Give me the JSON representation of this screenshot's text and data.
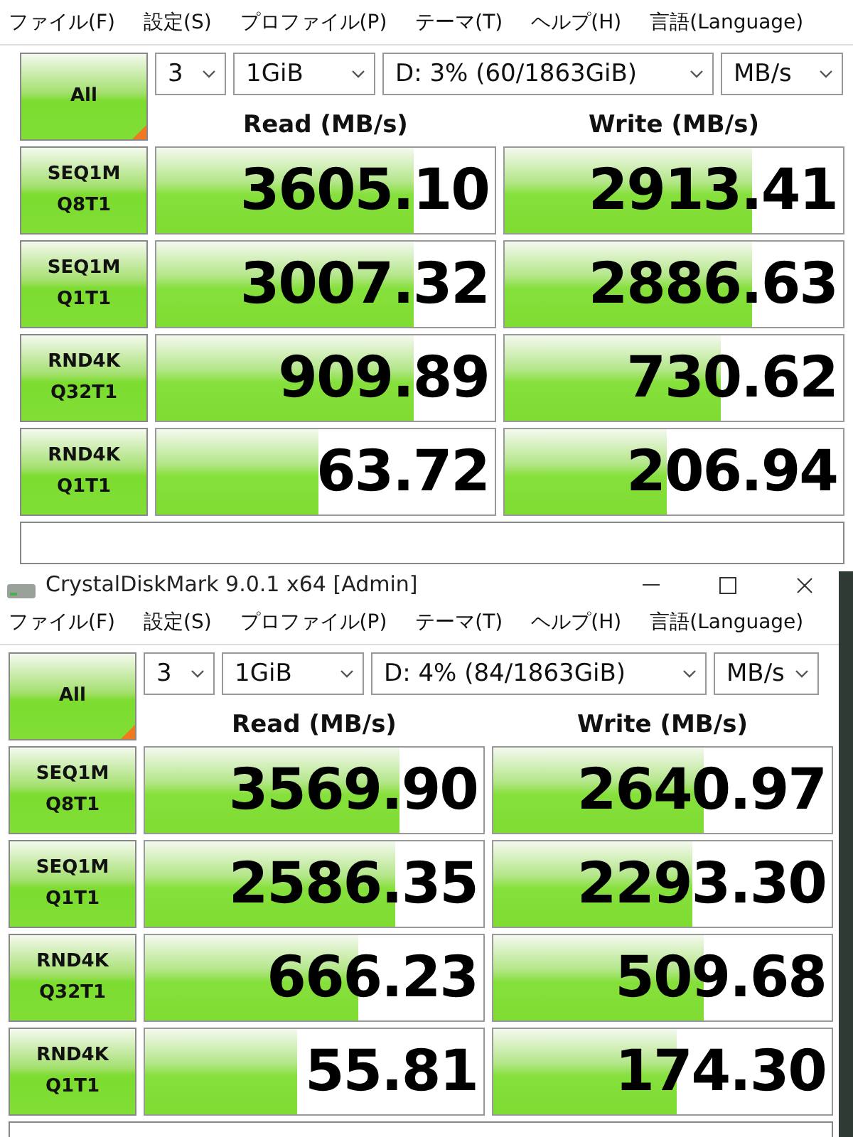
{
  "windows": [
    {
      "menu": [
        "ファイル(F)",
        "設定(S)",
        "プロファイル(P)",
        "テーマ(T)",
        "ヘルプ(H)",
        "言語(Language)"
      ],
      "all_button": "All",
      "count": "3",
      "size": "1GiB",
      "drive": "D: 3% (60/1863GiB)",
      "unit": "MB/s",
      "read_header": "Read (MB/s)",
      "write_header": "Write (MB/s)",
      "rows": [
        {
          "test": "SEQ1M",
          "params": "Q8T1",
          "read": {
            "value": "3605.10",
            "level": 0.76
          },
          "write": {
            "value": "2913.41",
            "level": 0.73
          }
        },
        {
          "test": "SEQ1M",
          "params": "Q1T1",
          "read": {
            "value": "3007.32",
            "level": 0.76
          },
          "write": {
            "value": "2886.63",
            "level": 0.73
          }
        },
        {
          "test": "RND4K",
          "params": "Q32T1",
          "read": {
            "value": "909.89",
            "level": 0.76
          },
          "write": {
            "value": "730.62",
            "level": 0.64
          }
        },
        {
          "test": "RND4K",
          "params": "Q1T1",
          "read": {
            "value": "63.72",
            "level": 0.48
          },
          "write": {
            "value": "206.94",
            "level": 0.48
          }
        }
      ]
    },
    {
      "title": "CrystalDiskMark 9.0.1 x64 [Admin]",
      "menu": [
        "ファイル(F)",
        "設定(S)",
        "プロファイル(P)",
        "テーマ(T)",
        "ヘルプ(H)",
        "言語(Language)"
      ],
      "all_button": "All",
      "count": "3",
      "size": "1GiB",
      "drive": "D: 4% (84/1863GiB)",
      "unit": "MB/s",
      "read_header": "Read (MB/s)",
      "write_header": "Write (MB/s)",
      "rows": [
        {
          "test": "SEQ1M",
          "params": "Q8T1",
          "read": {
            "value": "3569.90",
            "level": 0.75
          },
          "write": {
            "value": "2640.97",
            "level": 0.62
          }
        },
        {
          "test": "SEQ1M",
          "params": "Q1T1",
          "read": {
            "value": "2586.35",
            "level": 0.74
          },
          "write": {
            "value": "2293.30",
            "level": 0.59
          }
        },
        {
          "test": "RND4K",
          "params": "Q32T1",
          "read": {
            "value": "666.23",
            "level": 0.63
          },
          "write": {
            "value": "509.68",
            "level": 0.62
          }
        },
        {
          "test": "RND4K",
          "params": "Q1T1",
          "read": {
            "value": "55.81",
            "level": 0.45
          },
          "write": {
            "value": "174.30",
            "level": 0.54
          }
        }
      ]
    }
  ]
}
